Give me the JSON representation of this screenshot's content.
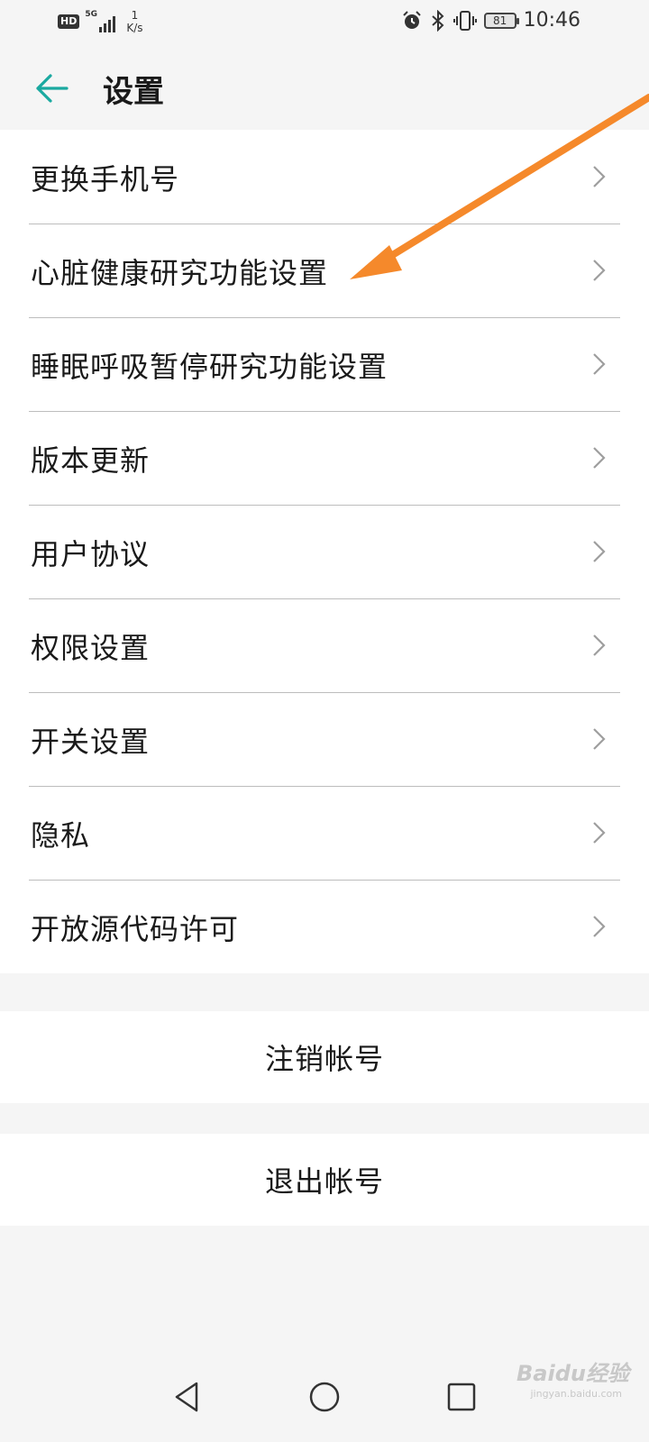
{
  "status_bar": {
    "hd": "HD",
    "network": "5G",
    "net_speed_value": "1",
    "net_speed_unit": "K/s",
    "battery": "81",
    "time": "10:46"
  },
  "header": {
    "title": "设置"
  },
  "settings_list": [
    {
      "label": "更换手机号"
    },
    {
      "label": "心脏健康研究功能设置"
    },
    {
      "label": "睡眠呼吸暂停研究功能设置"
    },
    {
      "label": "版本更新"
    },
    {
      "label": "用户协议"
    },
    {
      "label": "权限设置"
    },
    {
      "label": "开关设置"
    },
    {
      "label": "隐私"
    },
    {
      "label": "开放源代码许可"
    }
  ],
  "actions": {
    "cancel_account": "注销帐号",
    "logout": "退出帐号"
  },
  "watermark": {
    "brand": "Baidu经验",
    "url": "jingyan.baidu.com"
  },
  "colors": {
    "accent": "#1aa9a0",
    "annotation_arrow": "#f5892b"
  }
}
